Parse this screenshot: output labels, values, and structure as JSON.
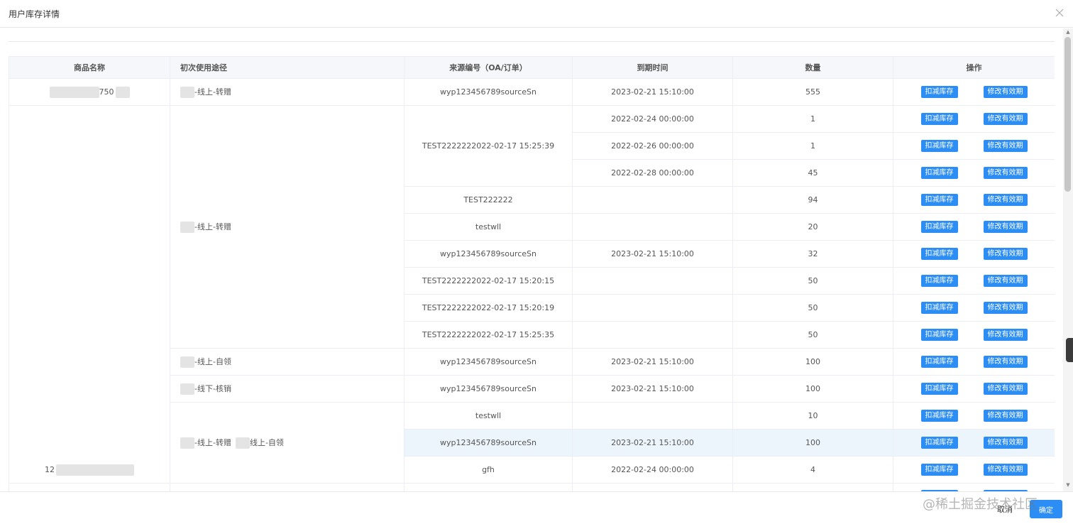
{
  "dialog": {
    "title": "用户库存详情"
  },
  "table": {
    "headers": [
      "商品名称",
      "初次使用途径",
      "来源编号（OA/订单）",
      "到期时间",
      "数量",
      "操作"
    ],
    "rows": [
      {
        "product": "750",
        "channel": "-线上-转赠",
        "source": "wyp123456789sourceSn",
        "expiry": "2023-02-21 15:10:00",
        "qty": "555"
      },
      {
        "product": "12",
        "channel": "-线上-转赠",
        "source": "TEST2222222022-02-17 15:25:39",
        "expiry": "2022-02-24 00:00:00",
        "qty": "1"
      },
      {
        "expiry": "2022-02-26 00:00:00",
        "qty": "1"
      },
      {
        "expiry": "2022-02-28 00:00:00",
        "qty": "45"
      },
      {
        "source": "TEST222222",
        "expiry": "",
        "qty": "94"
      },
      {
        "source": "testwll",
        "expiry": "",
        "qty": "20"
      },
      {
        "source": "wyp123456789sourceSn",
        "expiry": "2023-02-21 15:10:00",
        "qty": "32"
      },
      {
        "source": "TEST2222222022-02-17 15:20:15",
        "expiry": "",
        "qty": "50"
      },
      {
        "source": "TEST2222222022-02-17 15:20:19",
        "expiry": "",
        "qty": "50"
      },
      {
        "source": "TEST2222222022-02-17 15:25:35",
        "expiry": "",
        "qty": "50"
      },
      {
        "channel": "-线上-自领",
        "source": "wyp123456789sourceSn",
        "expiry": "2023-02-21 15:10:00",
        "qty": "100"
      },
      {
        "channel": "-线下-核销",
        "source": "wyp123456789sourceSn",
        "expiry": "2023-02-21 15:10:00",
        "qty": "100"
      },
      {
        "channel": "-线上-转赠",
        "channel_extra": "线上-自领",
        "source": "testwll",
        "expiry": "",
        "qty": "10"
      },
      {
        "source": "wyp123456789sourceSn",
        "expiry": "2023-02-21 15:10:00",
        "qty": "100"
      },
      {
        "source": "gfh",
        "expiry": "2022-02-24 00:00:00",
        "qty": "4"
      }
    ]
  },
  "actions": {
    "deduct": "扣减库存",
    "modify": "修改有效期"
  },
  "footer": {
    "cancel": "取消",
    "ok": "确定"
  },
  "watermark": "@稀土掘金技术社区",
  "colors": {
    "primary": "#2c8df4",
    "row_highlight": "#edf5fc",
    "header_bg": "#f5f7fa"
  }
}
